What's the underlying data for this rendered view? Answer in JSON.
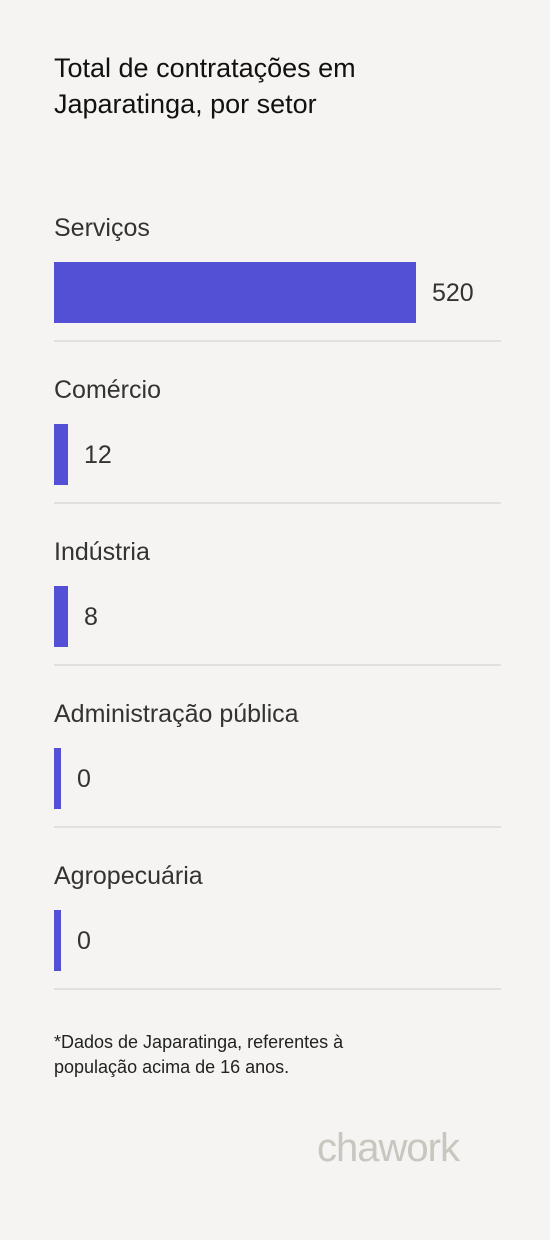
{
  "title": {
    "line1": "Total de contratações em",
    "line2": "Japaratinga, por setor"
  },
  "chart_data": {
    "type": "bar",
    "orientation": "horizontal",
    "title": "Total de contratações em Japaratinga, por setor",
    "categories": [
      "Serviços",
      "Comércio",
      "Indústria",
      "Administração pública",
      "Agropecuária"
    ],
    "values": [
      520,
      12,
      8,
      0,
      0
    ],
    "xlim": [
      0,
      520
    ],
    "bar_color": "#5450d6",
    "grid": false,
    "legend": "none"
  },
  "footnote": {
    "line1": "*Dados de Japaratinga, referentes à",
    "line2": "população acima de 16 anos."
  },
  "brand": {
    "logo_text": "chawork"
  },
  "colors": {
    "background": "#f5f4f2",
    "bar": "#5450d6",
    "divider": "#e2e0dc",
    "logo": "#c9c6bf"
  }
}
